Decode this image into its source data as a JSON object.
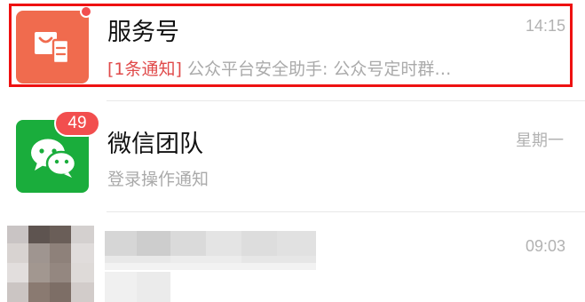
{
  "chats": [
    {
      "name": "服务号",
      "time": "14:15",
      "tag": "[1条通知]",
      "preview": " 公众平台安全助手: 公众号定时群…",
      "avatar_icon": "shopping-bag-icon",
      "avatar_color": "#f06b4e",
      "unread_dot": true,
      "highlighted": true,
      "highlight_color": "#ee1111"
    },
    {
      "name": "微信团队",
      "time": "星期一",
      "preview": "登录操作通知",
      "avatar_icon": "wechat-logo-icon",
      "avatar_color": "#1aad3c",
      "unread_count": "49"
    },
    {
      "name": "",
      "time": "09:03",
      "preview": "",
      "obscured": true
    }
  ],
  "colors": {
    "badge": "#f24e4e",
    "tag": "#e04a4a",
    "muted_text": "#aaaaaa",
    "time_text": "#b2b2b2",
    "name_text": "#111111"
  }
}
